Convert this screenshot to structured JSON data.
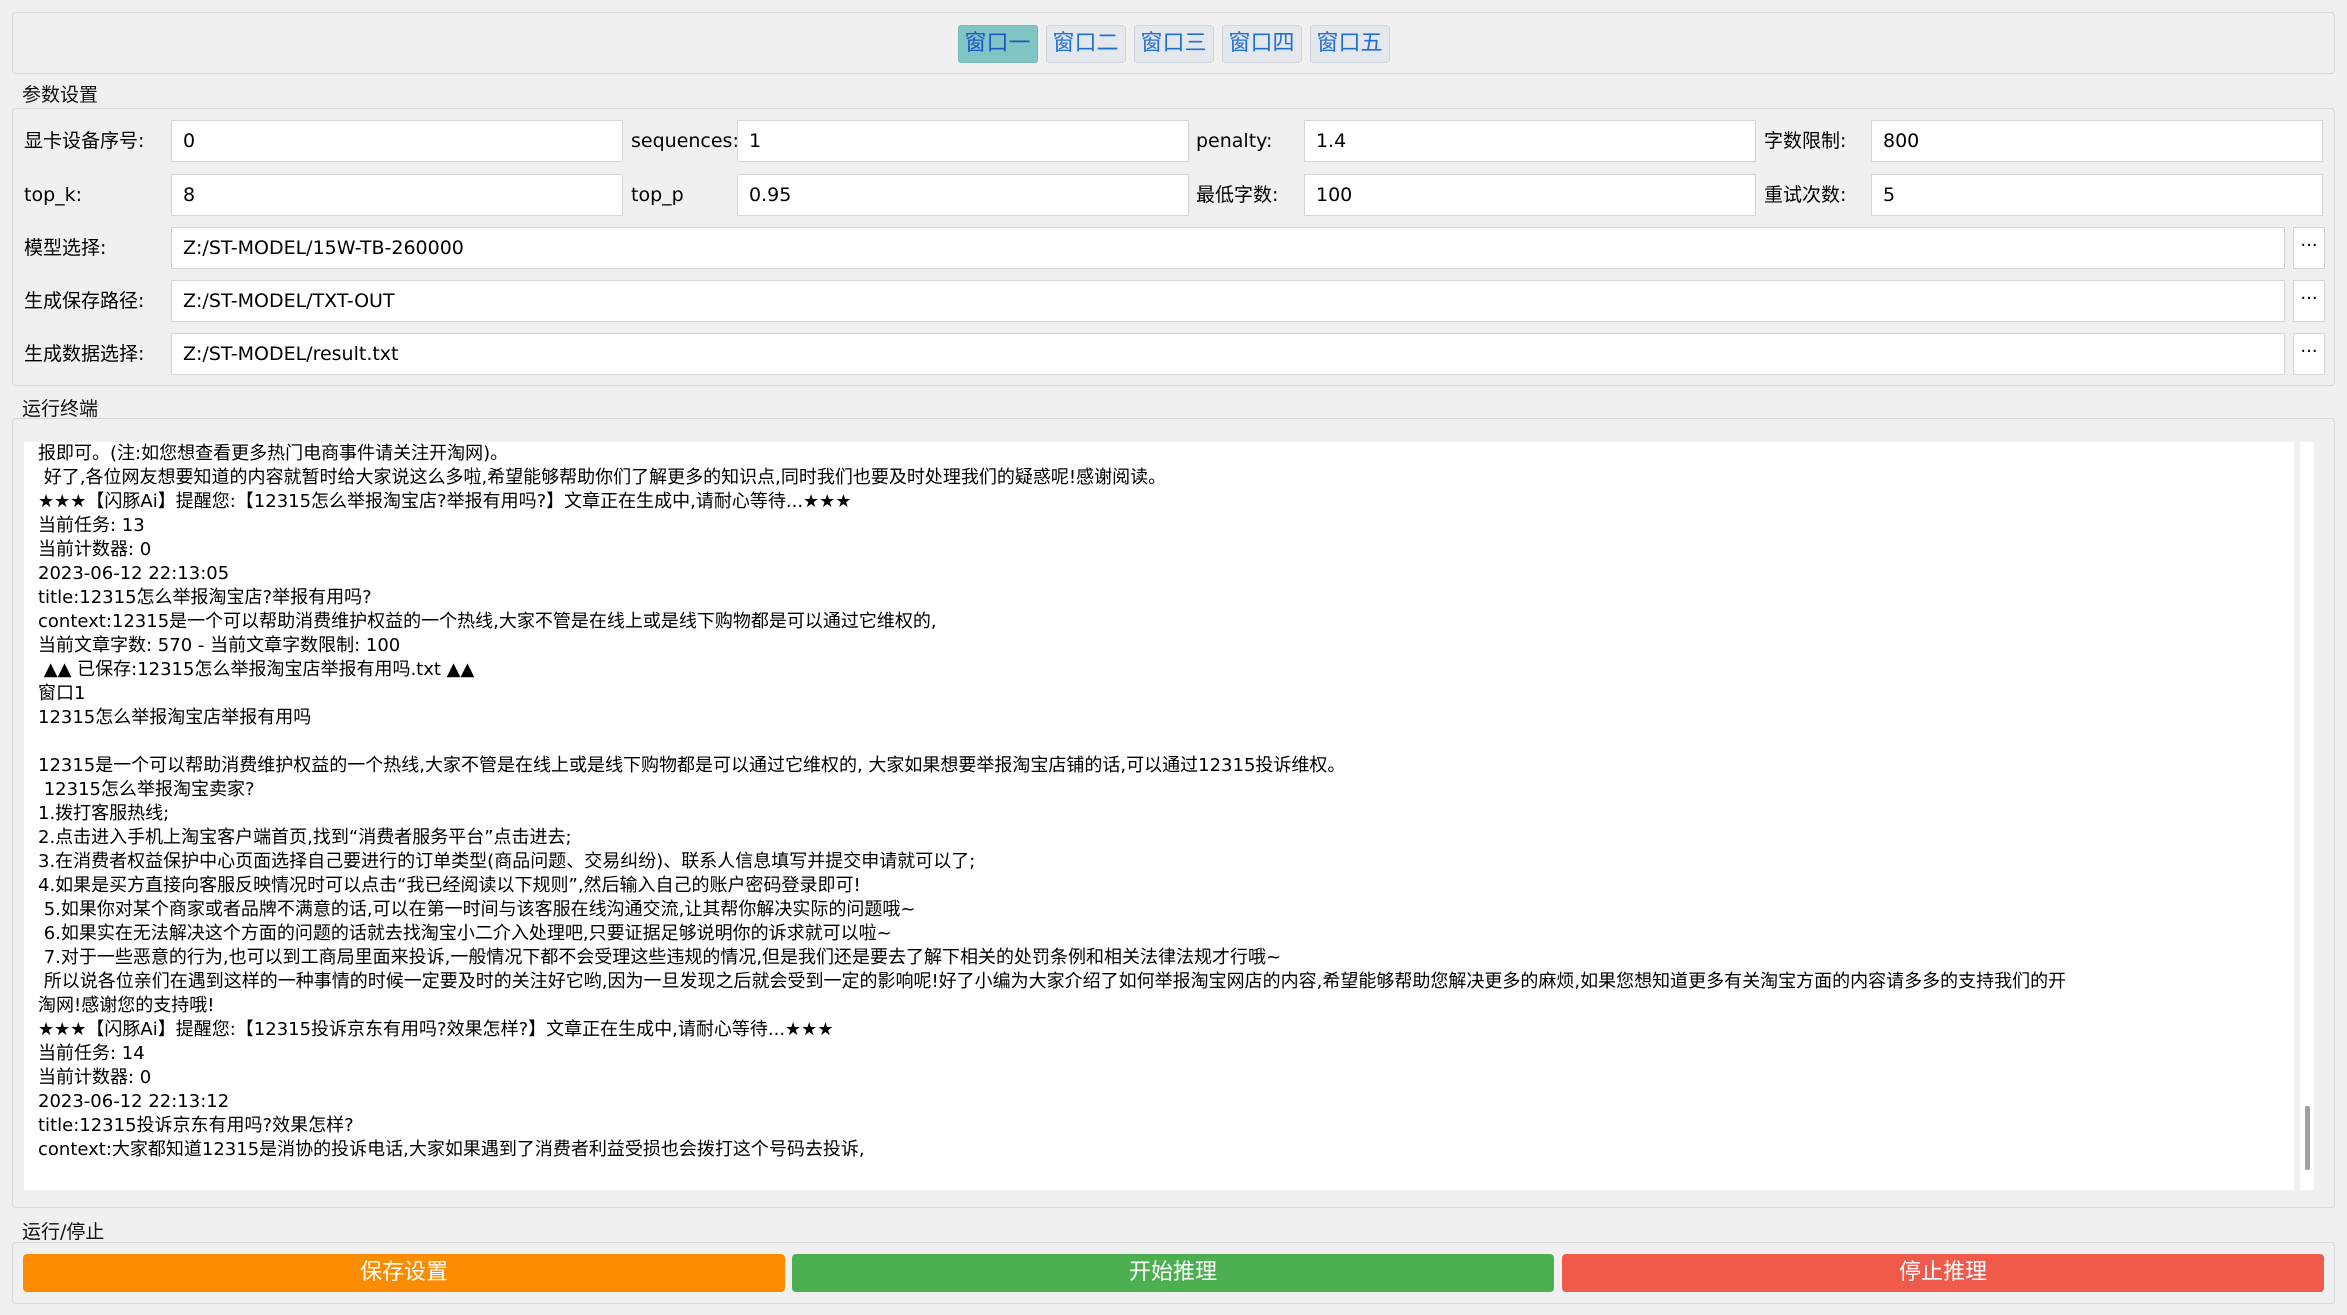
{
  "tabs": [
    "窗口一",
    "窗口二",
    "窗口三",
    "窗口四",
    "窗口五"
  ],
  "active_tab": 0,
  "params": {
    "title": "参数设置",
    "gpu_label": "显卡设备序号:",
    "gpu_value": "0",
    "sequences_label": "sequences:",
    "sequences_value": "1",
    "penalty_label": "penalty:",
    "penalty_value": "1.4",
    "word_limit_label": "字数限制:",
    "word_limit_value": "800",
    "topk_label": "top_k:",
    "topk_value": "8",
    "topp_label": "top_p",
    "topp_value": "0.95",
    "min_words_label": "最低字数:",
    "min_words_value": "100",
    "retry_label": "重试次数:",
    "retry_value": "5",
    "model_label": "模型选择:",
    "model_value": "Z:/ST-MODEL/15W-TB-260000",
    "save_path_label": "生成保存路径:",
    "save_path_value": "Z:/ST-MODEL/TXT-OUT",
    "data_label": "生成数据选择:",
    "data_value": "Z:/ST-MODEL/result.txt",
    "browse_label": "···"
  },
  "terminal": {
    "title": "运行终端",
    "lines": [
      "报即可。(注:如您想查看更多热门电商事件请关注开淘网)。",
      " 好了,各位网友想要知道的内容就暂时给大家说这么多啦,希望能够帮助你们了解更多的知识点,同时我们也要及时处理我们的疑惑呢!感谢阅读。",
      "★★★【闪豚Ai】提醒您:【12315怎么举报淘宝店?举报有用吗?】文章正在生成中,请耐心等待...★★★",
      "当前任务: 13",
      "当前计数器: 0",
      "2023-06-12 22:13:05",
      "title:12315怎么举报淘宝店?举报有用吗?",
      "context:12315是一个可以帮助消费维护权益的一个热线,大家不管是在线上或是线下购物都是可以通过它维权的,",
      "当前文章字数: 570 - 当前文章字数限制: 100",
      " ▲▲ 已保存:12315怎么举报淘宝店举报有用吗.txt ▲▲",
      "窗口1",
      "12315怎么举报淘宝店举报有用吗",
      "",
      "12315是一个可以帮助消费维护权益的一个热线,大家不管是在线上或是线下购物都是可以通过它维权的, 大家如果想要举报淘宝店铺的话,可以通过12315投诉维权。",
      " 12315怎么举报淘宝卖家?",
      "1.拨打客服热线;",
      "2.点击进入手机上淘宝客户端首页,找到“消费者服务平台”点击进去;",
      "3.在消费者权益保护中心页面选择自己要进行的订单类型(商品问题、交易纠纷)、联系人信息填写并提交申请就可以了;",
      "4.如果是买方直接向客服反映情况时可以点击“我已经阅读以下规则”,然后输入自己的账户密码登录即可!",
      " 5.如果你对某个商家或者品牌不满意的话,可以在第一时间与该客服在线沟通交流,让其帮你解决实际的问题哦~",
      " 6.如果实在无法解决这个方面的问题的话就去找淘宝小二介入处理吧,只要证据足够说明你的诉求就可以啦~",
      " 7.对于一些恶意的行为,也可以到工商局里面来投诉,一般情况下都不会受理这些违规的情况,但是我们还是要去了解下相关的处罚条例和相关法律法规才行哦~",
      " 所以说各位亲们在遇到这样的一种事情的时候一定要及时的关注好它哟,因为一旦发现之后就会受到一定的影响呢!好了小编为大家介绍了如何举报淘宝网店的内容,希望能够帮助您解决更多的麻烦,如果您想知道更多有关淘宝方面的内容请多多的支持我们的开",
      "淘网!感谢您的支持哦!",
      "★★★【闪豚Ai】提醒您:【12315投诉京东有用吗?效果怎样?】文章正在生成中,请耐心等待...★★★",
      "当前任务: 14",
      "当前计数器: 0",
      "2023-06-12 22:13:12",
      "title:12315投诉京东有用吗?效果怎样?",
      "context:大家都知道12315是消协的投诉电话,大家如果遇到了消费者利益受损也会拨打这个号码去投诉,"
    ]
  },
  "control": {
    "title": "运行/停止",
    "save_label": "保存设置",
    "start_label": "开始推理",
    "stop_label": "停止推理"
  },
  "colors": {
    "save": "#fb8c00",
    "start": "#4caf50",
    "stop": "#ef5a4b",
    "tab_active": "#80c5c4",
    "tab_text": "#1e6fd6"
  }
}
